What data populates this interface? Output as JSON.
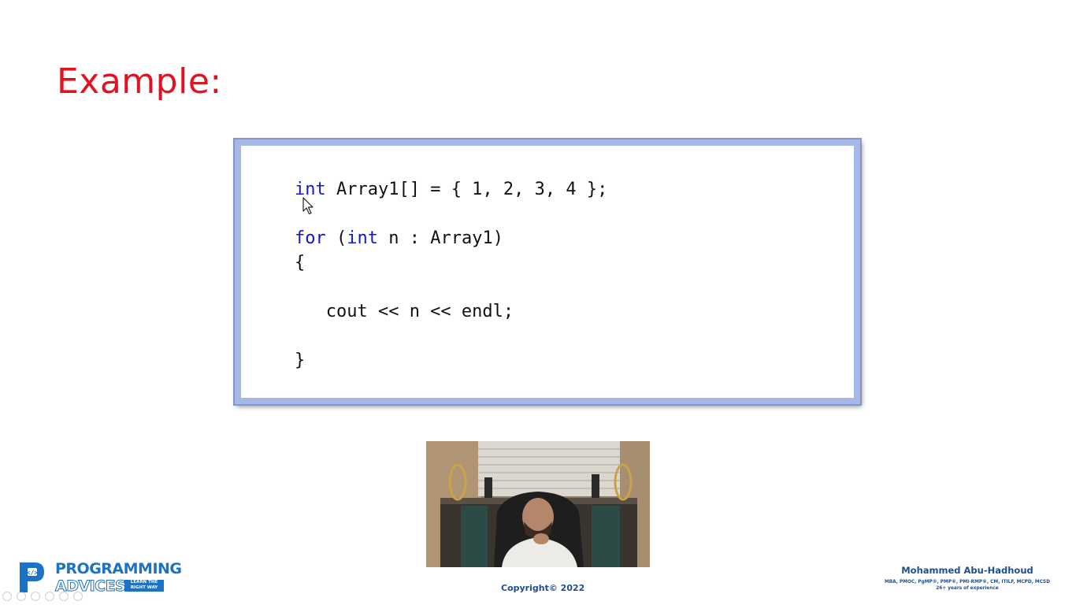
{
  "slide": {
    "title": "Example:",
    "code_lines": [
      [
        "kw:int",
        " Array1[] = { 1, 2, 3, 4 };"
      ],
      [],
      [
        "kw:for",
        " (",
        "kw:int",
        " n : Array1)"
      ],
      [
        "{"
      ],
      [],
      [
        "   cout << n << endl;"
      ],
      [],
      [
        "}"
      ]
    ],
    "copyright": "Copyright© 2022"
  },
  "logo": {
    "line1": "PROGRAMMING",
    "line2": "ADVICES",
    "tagline": "LEARN THE\nRIGHT WAY"
  },
  "author": {
    "name": "Mohammed Abu-Hadhoud",
    "credentials": "MBA, PMOC, PgMP®, PMP®, PMI-RMP®, CM, ITILF, MCPD, MCSD",
    "experience": "26+ years of experience"
  },
  "icons": {
    "cursor": "mouse-pointer-icon",
    "logo_mark": "programming-advices-logo-icon",
    "video": "presenter-webcam-video"
  },
  "colors": {
    "title": "#e0141e",
    "keyword": "#1515d6",
    "frame": "#a6b8e8",
    "brand": "#1c72c4"
  }
}
